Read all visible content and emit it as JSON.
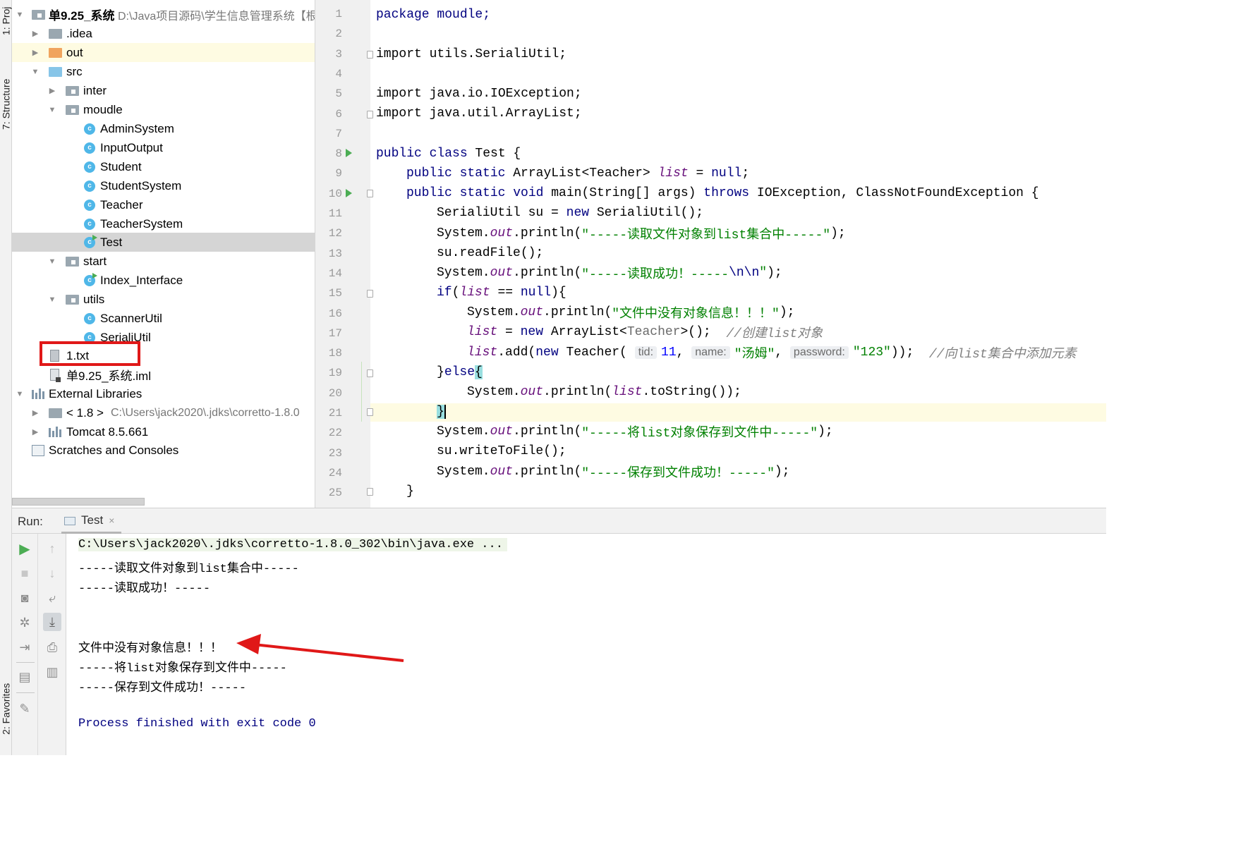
{
  "side_tabs": {
    "project": "1: Proj",
    "structure": "7: Structure",
    "favorites": "2: Favorites"
  },
  "project_tree": {
    "root_name": "单9.25_系统",
    "root_path": "D:\\Java项目源码\\学生信息管理系统【根",
    "idea": ".idea",
    "out": "out",
    "src": "src",
    "inter": "inter",
    "moudle": "moudle",
    "moudle_classes": [
      "AdminSystem",
      "InputOutput",
      "Student",
      "StudentSystem",
      "Teacher",
      "TeacherSystem",
      "Test"
    ],
    "start": "start",
    "index_interface": "Index_Interface",
    "utils": "utils",
    "utils_classes": [
      "ScannerUtil",
      "SerialiUtil"
    ],
    "txt_file": "1.txt",
    "iml_file": "单9.25_系统.iml",
    "external_libraries": "External Libraries",
    "jdk_name": "< 1.8 >",
    "jdk_path": "C:\\Users\\jack2020\\.jdks\\corretto-1.8.0",
    "tomcat": "Tomcat 8.5.661",
    "scratches": "Scratches and Consoles",
    "class_icon_letter": "c"
  },
  "editor": {
    "line_numbers": [
      "1",
      "2",
      "3",
      "4",
      "5",
      "6",
      "7",
      "8",
      "9",
      "10",
      "11",
      "12",
      "13",
      "14",
      "15",
      "16",
      "17",
      "18",
      "19",
      "20",
      "21",
      "22",
      "23",
      "24",
      "25"
    ],
    "lines": {
      "l1": "package moudle;",
      "l3": "import utils.SerialiUtil;",
      "l5": "import java.io.IOException;",
      "l6": "import java.util.ArrayList;",
      "l8_kw": "public class",
      "l8_rest": " Test {",
      "l9_kw": "public static",
      "l9_type": " ArrayList<Teacher> ",
      "l9_var": "list",
      "l9_eq": " = ",
      "l9_null": "null",
      "l9_end": ";",
      "l10_kw": "public static void",
      "l10_rest": " main(String[] args) ",
      "l10_throws": "throws",
      "l10_end": " IOException, ClassNotFoundException {",
      "l11_a": "SerialiUtil su = ",
      "l11_new": "new",
      "l11_b": " SerialiUtil();",
      "sys": "System.",
      "out": "out",
      "println": ".println(",
      "l12_str": "\"-----读取文件对象到list集合中-----\"",
      "close_paren": ");",
      "l13": "su.readFile();",
      "l14_str_a": "\"-----读取成功！-----",
      "l14_escape": "\\n\\n",
      "l14_str_b": "\"",
      "l15_if": "if",
      "l15_paren": "(",
      "l15_list": "list",
      "l15_eq": " == ",
      "l15_null": "null",
      "l15_end": "){",
      "l16_str": "\"文件中没有对象信息！！！\"",
      "l17_list": "list",
      "l17_eq": " = ",
      "l17_new": "new",
      "l17_type_a": " ArrayList<",
      "l17_type_b": "Teacher",
      "l17_type_c": ">();",
      "l17_cmt": "//创建list对象",
      "l18_list": "list",
      "l18_add": ".add(",
      "l18_new": "new",
      "l18_teacher": " Teacher( ",
      "l18_p_tid": "tid:",
      "l18_v_tid": "11",
      "comma": ", ",
      "l18_p_name": "name:",
      "l18_v_name": "\"汤姆\"",
      "l18_p_pwd": "password:",
      "l18_v_pwd": "\"123\"",
      "l18_end": "));",
      "l18_cmt": "//向list集合中添加元素",
      "l19_brace": "}",
      "l19_else": "else",
      "l19_open": "{",
      "l20_a": ".println(",
      "l20_list": "list",
      "l20_b": ".toString());",
      "l21_brace": "}",
      "l22_str": "\"-----将list对象保存到文件中-----\"",
      "l23": "su.writeToFile();",
      "l24_str": "\"-----保存到文件成功！-----\"",
      "l25": "}"
    }
  },
  "run_panel": {
    "label": "Run:",
    "tab": "Test",
    "tab_close": "×",
    "console_lines": [
      "C:\\Users\\jack2020\\.jdks\\corretto-1.8.0_302\\bin\\java.exe ...",
      "-----读取文件对象到list集合中-----",
      "-----读取成功！-----",
      "文件中没有对象信息！！！",
      "-----将list对象保存到文件中-----",
      "-----保存到文件成功！-----",
      "Process finished with exit code 0"
    ],
    "toolbar_icons": [
      "rerun-icon",
      "stop-icon",
      "camera-icon",
      "debug-icon",
      "exit-icon",
      "layout-icon",
      "pin-icon",
      "up-arrow-icon",
      "down-arrow-icon",
      "soft-wrap-icon",
      "scroll-to-end-icon",
      "print-icon",
      "trash-icon"
    ]
  },
  "annotations": {
    "highlight_color": "#e01818"
  }
}
